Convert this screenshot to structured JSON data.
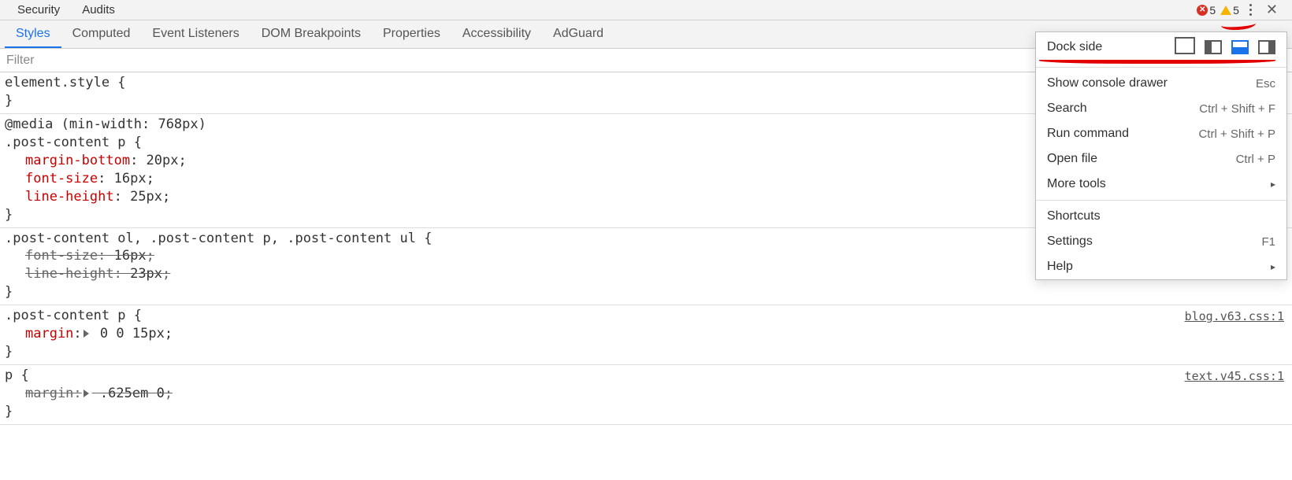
{
  "top_tabs": {
    "security": "Security",
    "audits": "Audits"
  },
  "counts": {
    "errors": "5",
    "warnings": "5"
  },
  "sub_tabs": {
    "styles": "Styles",
    "computed": "Computed",
    "event_listeners": "Event Listeners",
    "dom_breakpoints": "DOM Breakpoints",
    "properties": "Properties",
    "accessibility": "Accessibility",
    "adguard": "AdGuard"
  },
  "filter": {
    "placeholder": "Filter"
  },
  "rules": [
    {
      "selector": "element.style {",
      "close": "}",
      "decls": []
    },
    {
      "media": "@media (min-width: 768px)",
      "selector": ".post-content p {",
      "close": "}",
      "decls": [
        {
          "prop": "margin-bottom",
          "val": "20px",
          "strike": false,
          "expand": false
        },
        {
          "prop": "font-size",
          "val": "16px",
          "strike": false,
          "expand": false
        },
        {
          "prop": "line-height",
          "val": "25px",
          "strike": false,
          "expand": false
        }
      ]
    },
    {
      "selector": ".post-content ol, .post-content p, .post-content ul {",
      "close": "}",
      "decls": [
        {
          "prop": "font-size",
          "val": "16px",
          "strike": true,
          "expand": false
        },
        {
          "prop": "line-height",
          "val": "23px",
          "strike": true,
          "expand": false
        }
      ]
    },
    {
      "selector": ".post-content p {",
      "close": "}",
      "src": "blog.v63.css:1",
      "decls": [
        {
          "prop": "margin",
          "val": "0 0 15px",
          "strike": false,
          "expand": true
        }
      ]
    },
    {
      "selector": "p {",
      "close": "}",
      "src": "text.v45.css:1",
      "decls": [
        {
          "prop": "margin",
          "val": ".625em 0",
          "strike": true,
          "expand": true
        }
      ]
    }
  ],
  "menu": {
    "dock_label": "Dock side",
    "items": [
      {
        "label": "Show console drawer",
        "shortcut": "Esc"
      },
      {
        "label": "Search",
        "shortcut": "Ctrl + Shift + F"
      },
      {
        "label": "Run command",
        "shortcut": "Ctrl + Shift + P"
      },
      {
        "label": "Open file",
        "shortcut": "Ctrl + P"
      },
      {
        "label": "More tools",
        "shortcut": "▸"
      }
    ],
    "items2": [
      {
        "label": "Shortcuts",
        "shortcut": ""
      },
      {
        "label": "Settings",
        "shortcut": "F1"
      },
      {
        "label": "Help",
        "shortcut": "▸"
      }
    ]
  }
}
